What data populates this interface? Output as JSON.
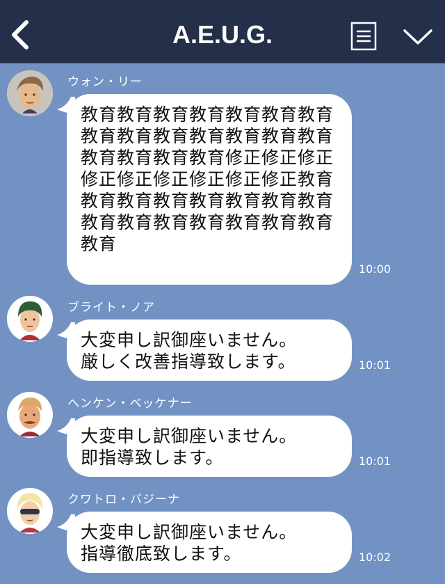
{
  "header": {
    "title": "A.E.U.G.",
    "back_icon": "chevron-left-icon",
    "notes_icon": "notes-icon",
    "menu_icon": "chevron-down-icon"
  },
  "colors": {
    "header_bg": "#242f4a",
    "chat_bg": "#7292c4",
    "bubble_bg": "#ffffff",
    "text_on_dark": "#ffffff"
  },
  "messages": [
    {
      "sender": "ウォン・リー",
      "text": "教育教育教育教育教育教育教育教育教育教育教育教育教育教育教育教育教育教育修正修正修正修正修正修正修正修正修正教育教育教育教育教育教育教育教育教育教育教育教育教育教育教育教育",
      "time": "10:00",
      "avatar_icon": "character-avatar-icon"
    },
    {
      "sender": "ブライト・ノア",
      "text": "大変申し訳御座いません。\n厳しく改善指導致します。",
      "time": "10:01",
      "avatar_icon": "character-avatar-icon"
    },
    {
      "sender": "ヘンケン・ベッケナー",
      "text": "大変申し訳御座いません。\n即指導致します。",
      "time": "10:01",
      "avatar_icon": "character-avatar-icon"
    },
    {
      "sender": "クワトロ・バジーナ",
      "text": "大変申し訳御座いません。\n指導徹底致します。",
      "time": "10:02",
      "avatar_icon": "character-avatar-icon"
    }
  ]
}
